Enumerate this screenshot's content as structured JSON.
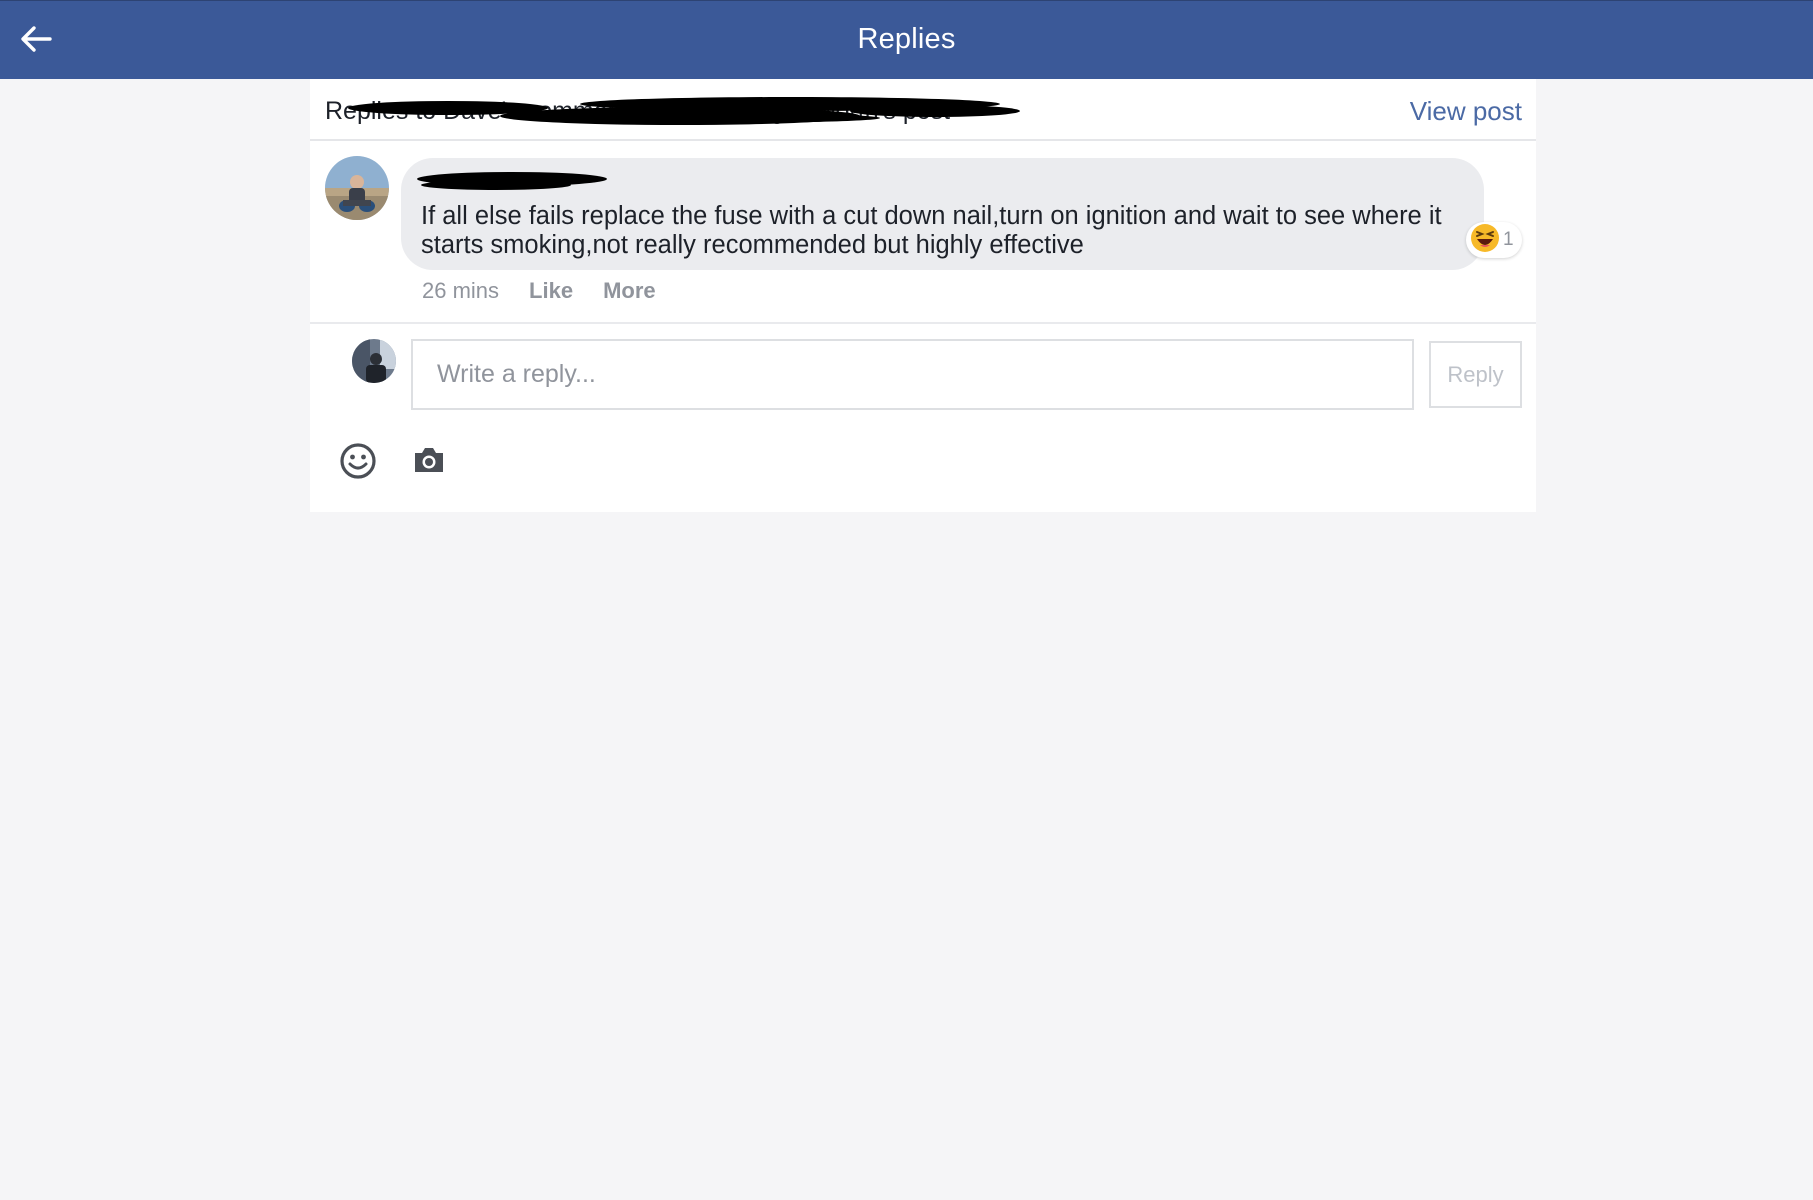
{
  "header": {
    "title": "Replies",
    "back_icon": "arrow-left-icon"
  },
  "context": {
    "text": "Replies to Dave's comment on Larry Knightsworth's post",
    "view_post_label": "View post"
  },
  "comment": {
    "author": "Redacted Name",
    "text": "If all else fails replace the fuse with a cut down nail,turn on ignition and wait to see where it starts smoking,not really recommended but highly effective",
    "time": "26 mins",
    "like_label": "Like",
    "more_label": "More",
    "reaction": {
      "icon": "laughing-face-icon",
      "count": "1"
    }
  },
  "composer": {
    "placeholder": "Write a reply...",
    "reply_label": "Reply",
    "tools": [
      "smiley-icon",
      "camera-icon"
    ]
  },
  "colors": {
    "brand": "#3b5998",
    "link": "#4b6aa5",
    "bubble": "#ebecef",
    "background": "#f5f5f7",
    "muted": "#90949c"
  }
}
